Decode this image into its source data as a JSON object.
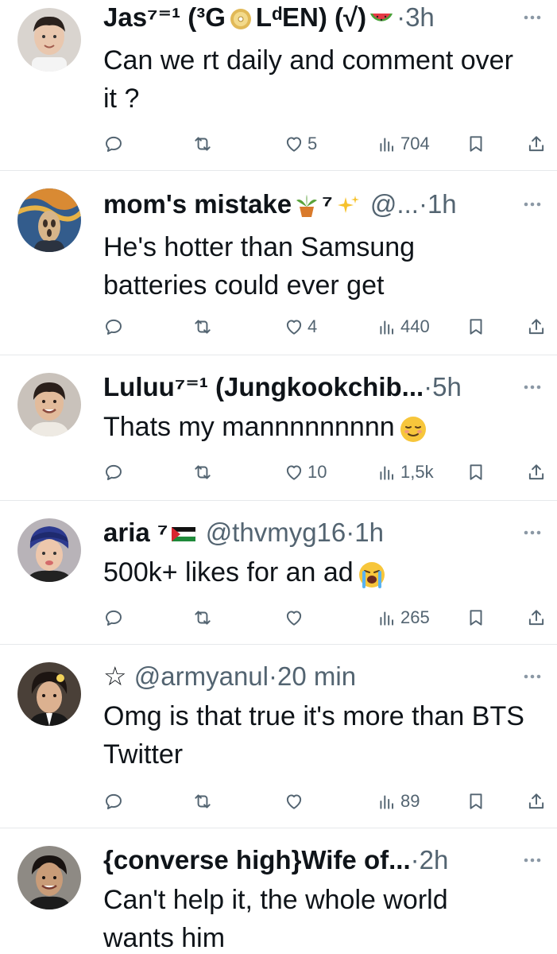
{
  "tweets": [
    {
      "name": "Jas⁷⁼¹ (³G",
      "name_tail": "LᵈEN) (√)",
      "handle": "",
      "time": "3h",
      "text": "Can we rt daily and comment over it ?",
      "likes": "5",
      "views": "704",
      "badges": [
        "gold-disc-emoji",
        "watermelon-emoji"
      ]
    },
    {
      "name": "mom's mistake",
      "name_tail": "⁷",
      "handle": "@...",
      "time": "1h",
      "text": "He's hotter than Samsung batteries could ever get",
      "likes": "4",
      "views": "440",
      "badges": [
        "potted-plant-emoji",
        "sparkles-emoji"
      ]
    },
    {
      "name": "Luluu⁷⁼¹ (Jungkookchib...",
      "name_tail": "",
      "handle": "",
      "time": "5h",
      "text": "Thats my mannnnnnnnn",
      "likes": "10",
      "views": "1,5k",
      "badges": [
        "relieved-face-emoji"
      ]
    },
    {
      "name": "aria",
      "name_tail": "⁷",
      "handle": "@thvmyg16",
      "time": "1h",
      "text": "500k+ likes for an ad",
      "likes": "",
      "views": "265",
      "badges": [
        "palestine-flag-emoji",
        "loudly-crying-face-emoji"
      ]
    },
    {
      "name": "☆",
      "name_tail": "",
      "handle": "@armyanul",
      "time": "20 min",
      "text": "Omg is that true it's more than BTS Twitter",
      "likes": "",
      "views": "89",
      "badges": []
    },
    {
      "name": "{converse high}Wife of...",
      "name_tail": "",
      "handle": "",
      "time": "2h",
      "text": "Can't help it, the whole world wants him",
      "likes": "",
      "views": "",
      "badges": []
    }
  ],
  "separator": "·",
  "colors": {
    "text": "#0f1419",
    "secondary": "#536471",
    "divider": "#e6e9eb"
  }
}
